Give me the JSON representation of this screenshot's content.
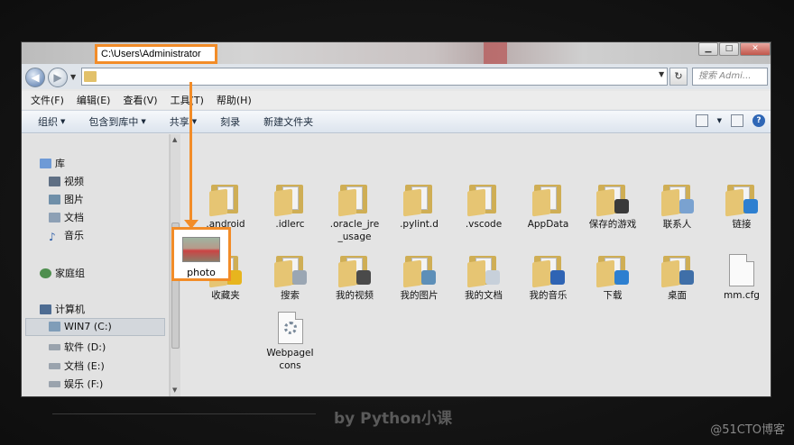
{
  "window": {
    "nav": {
      "back": "◀",
      "forward": "▶"
    },
    "address": "C:\\Users\\Administrator",
    "search_placeholder": "搜索 Admi...",
    "controls": [
      "▁",
      "□",
      "✕"
    ]
  },
  "menu": [
    "文件(F)",
    "编辑(E)",
    "查看(V)",
    "工具(T)",
    "帮助(H)"
  ],
  "toolbar": [
    {
      "label": "组织",
      "caret": true
    },
    {
      "label": "包含到库中",
      "caret": true
    },
    {
      "label": "共享",
      "caret": true
    },
    {
      "label": "刻录",
      "caret": false
    },
    {
      "label": "新建文件夹",
      "caret": false
    }
  ],
  "sidebar": {
    "library": "库",
    "items": [
      "视频",
      "图片",
      "文档",
      "音乐"
    ],
    "homegroup": "家庭组",
    "computer": "计算机",
    "drives": [
      "WIN7 (C:)",
      "软件 (D:)",
      "文档 (E:)",
      "娱乐 (F:)"
    ]
  },
  "files": [
    {
      "name": ".android",
      "icon": "folder-icon"
    },
    {
      "name": ".idlerc",
      "icon": "folder-icon"
    },
    {
      "name": ".oracle_jre_usage",
      "icon": "folder-icon"
    },
    {
      "name": ".pylint.d",
      "icon": "folder-icon"
    },
    {
      "name": ".vscode",
      "icon": "folder-icon"
    },
    {
      "name": "AppData",
      "icon": "folder-icon"
    },
    {
      "name": "保存的游戏",
      "icon": "saved-games-folder-icon"
    },
    {
      "name": "联系人",
      "icon": "contacts-folder-icon"
    },
    {
      "name": "链接",
      "icon": "links-folder-icon"
    },
    {
      "name": "收藏夹",
      "icon": "favorites-folder-icon"
    },
    {
      "name": "搜索",
      "icon": "searches-folder-icon"
    },
    {
      "name": "我的视频",
      "icon": "videos-folder-icon"
    },
    {
      "name": "我的图片",
      "icon": "pictures-folder-icon"
    },
    {
      "name": "我的文档",
      "icon": "documents-folder-icon"
    },
    {
      "name": "我的音乐",
      "icon": "music-folder-icon"
    },
    {
      "name": "下载",
      "icon": "downloads-folder-icon"
    },
    {
      "name": "桌面",
      "icon": "desktop-folder-icon"
    },
    {
      "name": "mm.cfg",
      "icon": "file-icon"
    },
    {
      "name": "photo",
      "icon": "image-file-icon"
    },
    {
      "name": "WebpageIcons",
      "icon": "settings-file-icon"
    }
  ],
  "caption": "by Python小课",
  "watermark": "@51CTO博客",
  "colors": {
    "highlight": "#f28c28"
  }
}
